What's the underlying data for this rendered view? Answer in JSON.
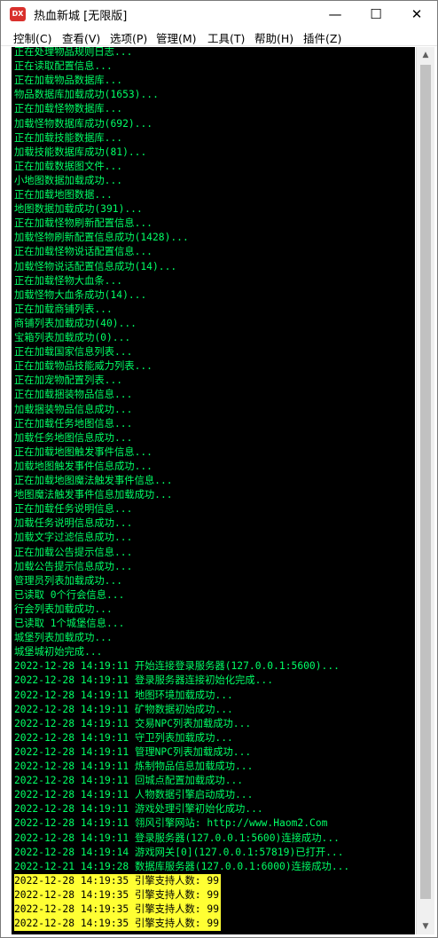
{
  "window": {
    "app_icon": "DX",
    "title": "热血新城 [无限版]",
    "minimize_glyph": "—",
    "maximize_glyph": "☐",
    "close_glyph": "✕"
  },
  "menu": [
    {
      "label": "控制(C)"
    },
    {
      "label": "查看(V)"
    },
    {
      "label": "选项(P)"
    },
    {
      "label": "管理(M)"
    },
    {
      "label": "工具(T)"
    },
    {
      "label": "帮助(H)"
    },
    {
      "label": "插件(Z)"
    }
  ],
  "colors": {
    "console_bg": "#000000",
    "console_text": "#00ff66",
    "highlight_bg": "#ffff33",
    "highlight_text": "#000000"
  },
  "log_lines": [
    {
      "text": "正在处理物品规则日志..."
    },
    {
      "text": "正在读取配置信息..."
    },
    {
      "text": "正在加载物品数据库..."
    },
    {
      "text": "物品数据库加载成功(1653)..."
    },
    {
      "text": "正在加载怪物数据库..."
    },
    {
      "text": "加载怪物数据库成功(692)..."
    },
    {
      "text": "正在加载技能数据库..."
    },
    {
      "text": "加载技能数据库成功(81)..."
    },
    {
      "text": "正在加载数据图文件..."
    },
    {
      "text": "小地图数据加载成功..."
    },
    {
      "text": "正在加载地图数据..."
    },
    {
      "text": "地图数据加载成功(391)..."
    },
    {
      "text": "正在加载怪物刷新配置信息..."
    },
    {
      "text": "加载怪物刷新配置信息成功(1428)..."
    },
    {
      "text": "正在加载怪物说话配置信息..."
    },
    {
      "text": "加载怪物说话配置信息成功(14)..."
    },
    {
      "text": "正在加载怪物大血条..."
    },
    {
      "text": "加载怪物大血条成功(14)..."
    },
    {
      "text": "正在加载商铺列表..."
    },
    {
      "text": "商铺列表加载成功(40)..."
    },
    {
      "text": "宝箱列表加载成功(0)..."
    },
    {
      "text": "正在加载国家信息列表..."
    },
    {
      "text": "正在加载物品技能威力列表..."
    },
    {
      "text": "正在加宠物配置列表..."
    },
    {
      "text": "正在加载捆装物品信息..."
    },
    {
      "text": "加载捆装物品信息成功..."
    },
    {
      "text": "正在加载任务地图信息..."
    },
    {
      "text": "加载任务地图信息成功..."
    },
    {
      "text": "正在加载地图触发事件信息..."
    },
    {
      "text": "加载地图触发事件信息成功..."
    },
    {
      "text": "正在加载地图魔法触发事件信息..."
    },
    {
      "text": "地图魔法触发事件信息加载成功..."
    },
    {
      "text": "正在加载任务说明信息..."
    },
    {
      "text": "加载任务说明信息成功..."
    },
    {
      "text": "加载文字过滤信息成功..."
    },
    {
      "text": "正在加载公告提示信息..."
    },
    {
      "text": "加载公告提示信息成功..."
    },
    {
      "text": "管理员列表加载成功..."
    },
    {
      "text": "已读取 0个行会信息..."
    },
    {
      "text": "行会列表加载成功..."
    },
    {
      "text": "已读取 1个城堡信息..."
    },
    {
      "text": "城堡列表加载成功..."
    },
    {
      "text": "城堡城初始完成..."
    },
    {
      "text": "2022-12-28 14:19:11 开始连接登录服务器(127.0.0.1:5600)..."
    },
    {
      "text": "2022-12-28 14:19:11 登录服务器连接初始化完成..."
    },
    {
      "text": "2022-12-28 14:19:11 地图环境加载成功..."
    },
    {
      "text": "2022-12-28 14:19:11 矿物数据初始成功..."
    },
    {
      "text": "2022-12-28 14:19:11 交易NPC列表加载成功..."
    },
    {
      "text": "2022-12-28 14:19:11 守卫列表加载成功..."
    },
    {
      "text": "2022-12-28 14:19:11 管理NPC列表加载成功..."
    },
    {
      "text": "2022-12-28 14:19:11 炼制物品信息加载成功..."
    },
    {
      "text": "2022-12-28 14:19:11 回城点配置加载成功..."
    },
    {
      "text": "2022-12-28 14:19:11 人物数据引擎启动成功..."
    },
    {
      "text": "2022-12-28 14:19:11 游戏处理引擎初始化成功..."
    },
    {
      "text": "2022-12-28 14:19:11 翎风引擎网站: http://www.Haom2.Com"
    },
    {
      "text": "2022-12-28 14:19:11 登录服务器(127.0.0.1:5600)连接成功..."
    },
    {
      "text": "2022-12-28 14:19:14 游戏网关[0](127.0.0.1:57819)已打开..."
    },
    {
      "text": "2022-12-21 14:19:28 数据库服务器(127.0.0.1:6000)连接成功..."
    },
    {
      "text": "2022-12-28 14:19:35 引擎支持人数: 99",
      "highlight": true
    },
    {
      "text": "2022-12-28 14:19:35 引擎支持人数: 99",
      "highlight": true
    },
    {
      "text": "2022-12-28 14:19:35 引擎支持人数: 99",
      "highlight": true
    },
    {
      "text": "2022-12-28 14:19:35 引擎支持人数: 99",
      "highlight": true
    }
  ],
  "scrollbar": {
    "up_glyph": "▲",
    "down_glyph": "▼"
  }
}
